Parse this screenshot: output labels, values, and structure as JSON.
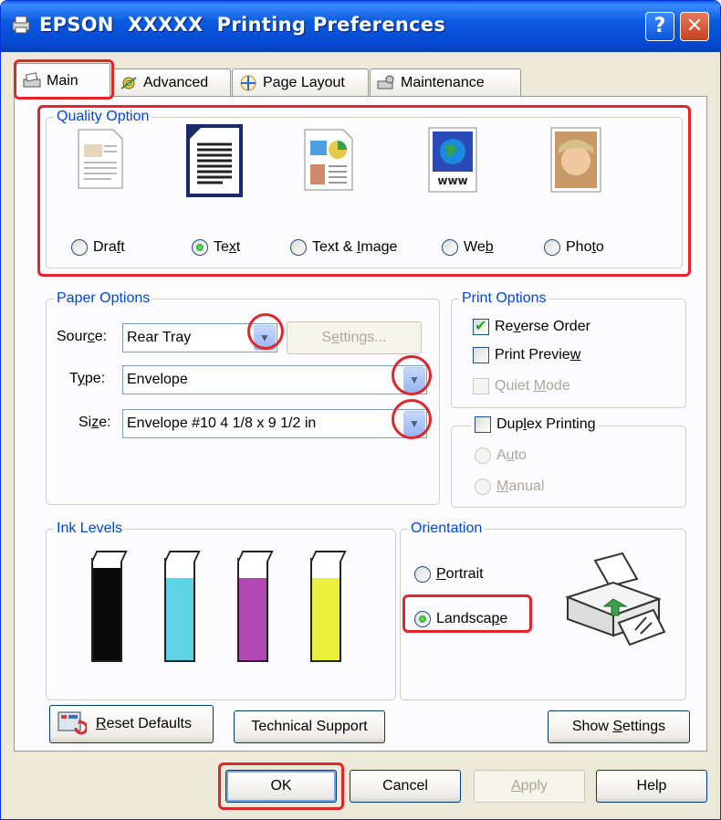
{
  "window": {
    "title": "EPSON  XXXXX  Printing Preferences",
    "help_button": "?",
    "close_button": "✕"
  },
  "tabs": [
    {
      "label": "Main",
      "active": true
    },
    {
      "label": "Advanced",
      "active": false
    },
    {
      "label": "Page Layout",
      "active": false
    },
    {
      "label": "Maintenance",
      "active": false
    }
  ],
  "quality": {
    "group_label": "Quality Option",
    "options": [
      {
        "pre": "Dra",
        "key": "f",
        "post": "t",
        "checked": false
      },
      {
        "pre": "Te",
        "key": "x",
        "post": "t",
        "checked": true
      },
      {
        "pre": "Text & ",
        "key": "I",
        "post": "mage",
        "checked": false
      },
      {
        "pre": "We",
        "key": "b",
        "post": "",
        "checked": false
      },
      {
        "pre": "Pho",
        "key": "t",
        "post": "o",
        "checked": false
      }
    ],
    "web_icon_text": "www"
  },
  "paper": {
    "group_label": "Paper Options",
    "source_label": {
      "pre": "Sour",
      "key": "c",
      "post": "e:"
    },
    "source_value": "Rear Tray",
    "settings_label": {
      "pre": "S",
      "key": "e",
      "post": "ttings..."
    },
    "type_label": {
      "pre": "T",
      "key": "y",
      "post": "pe:"
    },
    "type_value": "Envelope",
    "size_label": {
      "pre": "Si",
      "key": "z",
      "post": "e:"
    },
    "size_value": "Envelope #10 4 1/8 x 9 1/2 in"
  },
  "print_options": {
    "group_label": "Print Options",
    "reverse_order": {
      "pre": "Re",
      "key": "v",
      "post": "erse Order",
      "checked": true
    },
    "print_preview": {
      "pre": "Print Previe",
      "key": "w",
      "post": "",
      "checked": false
    },
    "quiet_mode": {
      "pre": "Quiet ",
      "key": "M",
      "post": "ode",
      "checked": false,
      "disabled": true
    }
  },
  "duplex": {
    "label": {
      "pre": "Dup",
      "key": "l",
      "post": "ex Printing"
    },
    "checked": false,
    "auto": {
      "pre": "A",
      "key": "u",
      "post": "to"
    },
    "manual": {
      "pre": "",
      "key": "M",
      "post": "anual"
    }
  },
  "ink": {
    "group_label": "Ink Levels",
    "colors": [
      "#0a0a0a",
      "#5fd3e6",
      "#b04ab2",
      "#ecef3a"
    ],
    "levels": [
      0.92,
      0.82,
      0.82,
      0.82
    ]
  },
  "orientation": {
    "group_label": "Orientation",
    "portrait": {
      "pre": "",
      "key": "P",
      "post": "ortrait",
      "checked": false
    },
    "landscape": {
      "pre": "Landsca",
      "key": "p",
      "post": "e",
      "checked": true
    }
  },
  "bottom": {
    "reset_defaults": {
      "pre": "",
      "key": "R",
      "post": "eset Defaults"
    },
    "technical_support": "Technical Support",
    "show_settings": {
      "pre": "Show ",
      "key": "S",
      "post": "ettings"
    }
  },
  "dialog": {
    "ok": "OK",
    "cancel": "Cancel",
    "apply": {
      "pre": "",
      "key": "A",
      "post": "pply"
    },
    "help": "Help"
  },
  "colors": {
    "highlight": "#e0262c",
    "titlebar": "#0a5ae0",
    "group_label": "#0046d5"
  }
}
